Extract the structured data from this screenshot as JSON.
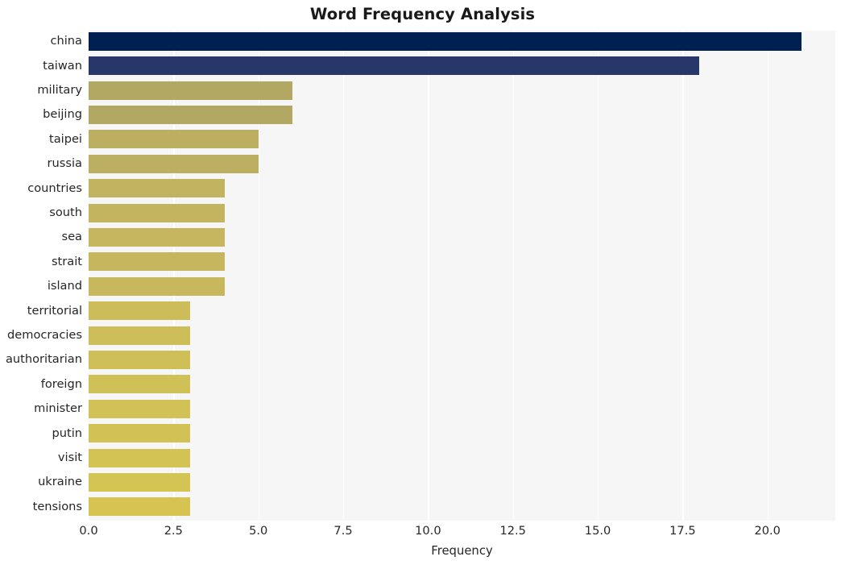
{
  "chart_data": {
    "type": "bar",
    "orientation": "horizontal",
    "title": "Word Frequency Analysis",
    "xlabel": "Frequency",
    "ylabel": "",
    "xlim": [
      0,
      22
    ],
    "xticks": [
      "0.0",
      "2.5",
      "5.0",
      "7.5",
      "10.0",
      "12.5",
      "15.0",
      "17.5",
      "20.0"
    ],
    "xtick_values": [
      0,
      2.5,
      5,
      7.5,
      10,
      12.5,
      15,
      17.5,
      20
    ],
    "grid": "vertical-white-on-light-gray",
    "legend": "none",
    "categories": [
      "china",
      "taiwan",
      "military",
      "beijing",
      "taipei",
      "russia",
      "countries",
      "south",
      "sea",
      "strait",
      "island",
      "territorial",
      "democracies",
      "authoritarian",
      "foreign",
      "minister",
      "putin",
      "visit",
      "ukraine",
      "tensions"
    ],
    "values": [
      21,
      18,
      6,
      6,
      5,
      5,
      4,
      4,
      4,
      4,
      4,
      3,
      3,
      3,
      3,
      3,
      3,
      3,
      3,
      3
    ],
    "bar_colors": [
      "#002051",
      "#27376a",
      "#b3a764",
      "#b3a764",
      "#bdaf62",
      "#bdaf62",
      "#c2b361",
      "#c3b460",
      "#c5b65f",
      "#c6b75f",
      "#c7b85e",
      "#cdbd5a",
      "#cebe59",
      "#cfbf59",
      "#d0c058",
      "#d1c157",
      "#d2c256",
      "#d3c355",
      "#d4c454",
      "#d6c352"
    ]
  },
  "figure": {
    "background": "#ffffff",
    "plot_background": "#f6f6f7",
    "title_color": "#1a1a1a",
    "tick_color": "#262626"
  }
}
